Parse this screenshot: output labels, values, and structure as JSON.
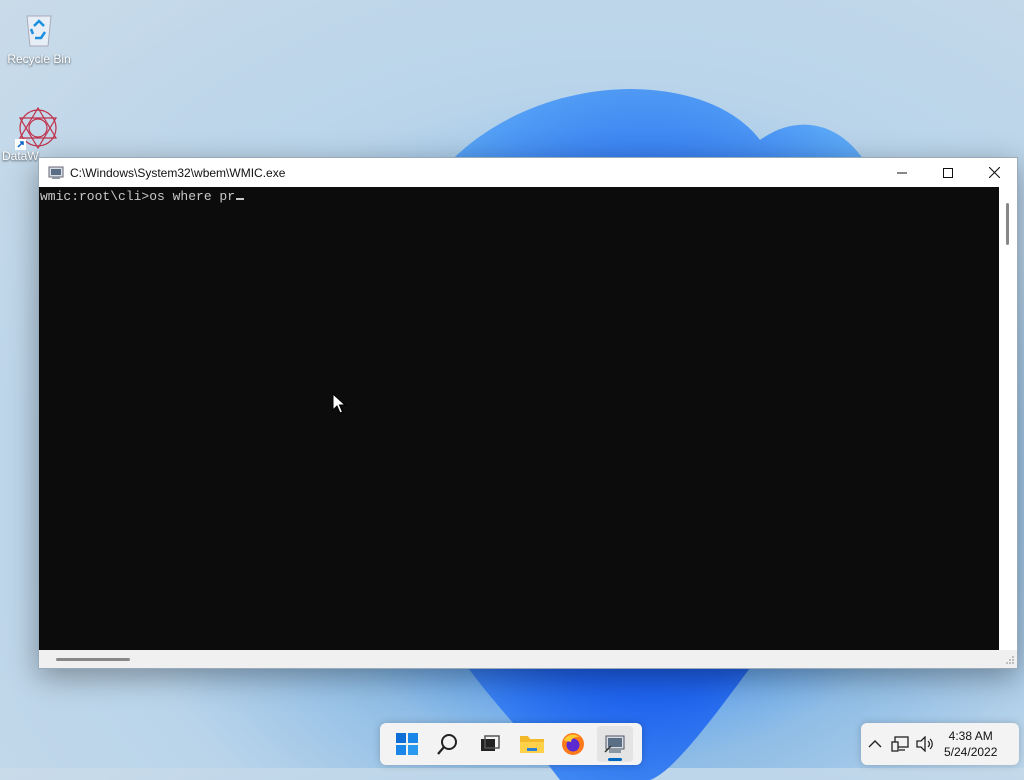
{
  "desktop": {
    "icons": [
      {
        "label": "Recycle Bin",
        "icon": "recycle-bin-icon"
      },
      {
        "label": "DataW",
        "icon": "datawrapper-icon"
      }
    ]
  },
  "window": {
    "title": "C:\\Windows\\System32\\wbem\\WMIC.exe",
    "controls": {
      "minimize": "minimize-icon",
      "maximize": "maximize-icon",
      "close": "close-icon"
    },
    "console": {
      "prompt": "wmic:root\\cli>",
      "input": "os where pr"
    }
  },
  "taskbar": {
    "apps": [
      "start-icon",
      "search-icon",
      "task-view-icon",
      "file-explorer-icon",
      "firefox-icon",
      "wmic-icon"
    ],
    "active": "wmic-icon",
    "accent_color": "#0067c0"
  },
  "tray": {
    "icons": [
      "chevron-up-icon",
      "network-icon",
      "volume-icon"
    ],
    "time": "4:38 AM",
    "date": "5/24/2022"
  }
}
